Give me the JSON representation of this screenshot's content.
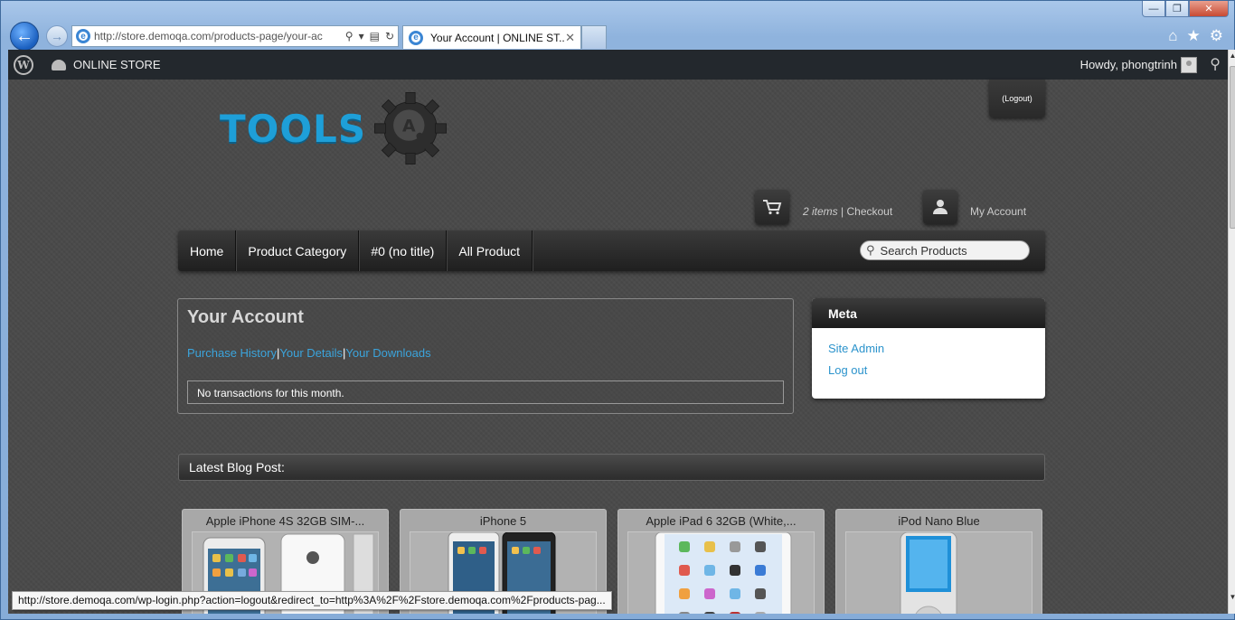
{
  "browser": {
    "address_url": "http://store.demoqa.com/products-page/your-ac",
    "tab_title": "Your Account | ONLINE ST...",
    "status_url": "http://store.demoqa.com/wp-login.php?action=logout&redirect_to=http%3A%2F%2Fstore.demoqa.com%2Fproducts-pag..."
  },
  "adminbar": {
    "site_name": "ONLINE STORE",
    "howdy": "Howdy, phongtrinh"
  },
  "header": {
    "logo_text": "TOOLS",
    "logo_letter": "A",
    "logout_label": "(Logout)",
    "cart_items": "2 items",
    "cart_sep": " | ",
    "checkout_label": "Checkout",
    "my_account_label": "My Account"
  },
  "nav": {
    "items": [
      "Home",
      "Product Category",
      "#0 (no title)",
      "All Product"
    ],
    "search_placeholder": "Search Products"
  },
  "account": {
    "title": "Your Account",
    "links": [
      "Purchase History",
      "Your Details",
      "Your Downloads"
    ],
    "separator": "|",
    "no_transactions": "No transactions for this month."
  },
  "meta": {
    "title": "Meta",
    "links": [
      "Site Admin",
      "Log out"
    ]
  },
  "blog": {
    "title": "Latest Blog Post:"
  },
  "products": [
    {
      "title": "Apple iPhone 4S 32GB SIM-..."
    },
    {
      "title": "iPhone 5"
    },
    {
      "title": "Apple iPad 6 32GB (White,..."
    },
    {
      "title": "iPod Nano Blue"
    }
  ],
  "colors": {
    "accent_blue": "#1e9fd8",
    "link_blue": "#3ba4dc",
    "admin_bar": "#23282d"
  }
}
